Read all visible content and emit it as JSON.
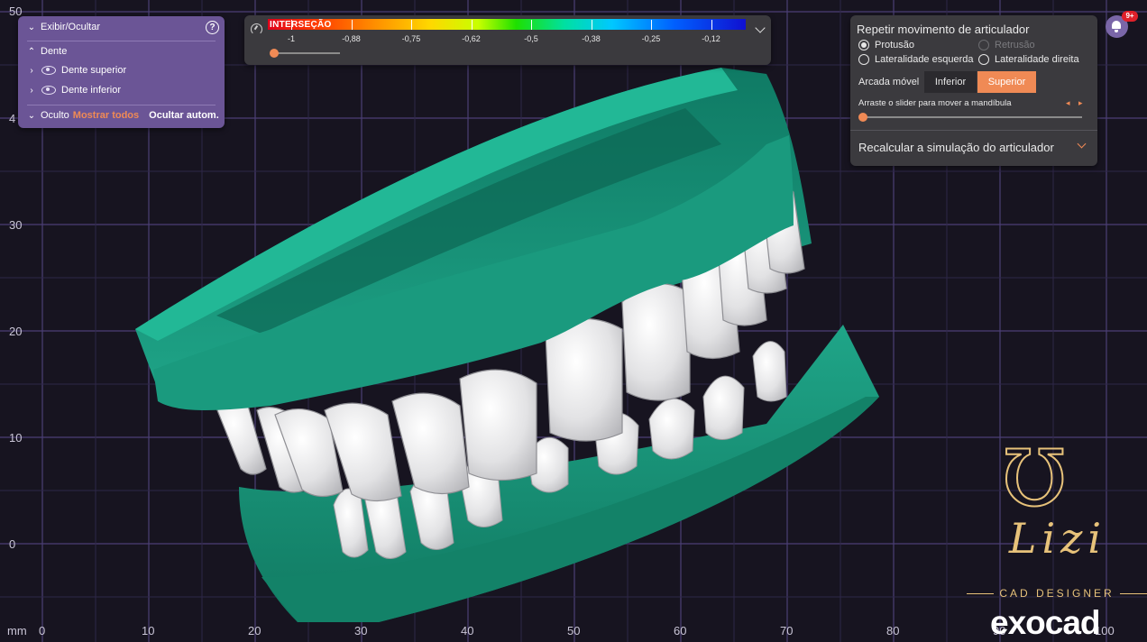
{
  "visibility_panel": {
    "title": "Exibir/Ocultar",
    "help_icon": "question-circle-icon",
    "group_label": "Dente",
    "items": [
      {
        "label": "Dente superior",
        "icon": "eye-icon"
      },
      {
        "label": "Dente inferior",
        "icon": "eye-icon"
      }
    ],
    "hidden_label": "Oculto",
    "show_all_label": "Mostrar todos",
    "auto_hide_label": "Ocultar autom."
  },
  "color_scale": {
    "title": "INTERSEÇÃO",
    "ticks": [
      "-1",
      "-0,88",
      "-0,75",
      "-0,62",
      "-0,5",
      "-0,38",
      "-0,25",
      "-0,12"
    ],
    "slider_value": 0.0
  },
  "articulator": {
    "title": "Repetir movimento de articulador",
    "options": [
      {
        "label": "Protusão",
        "selected": true,
        "disabled": false
      },
      {
        "label": "Retrusão",
        "selected": false,
        "disabled": true
      },
      {
        "label": "Lateralidade esquerda",
        "selected": false,
        "disabled": false
      },
      {
        "label": "Lateralidade direita",
        "selected": false,
        "disabled": false
      }
    ],
    "moving_arch_label": "Arcada móvel",
    "arch_buttons": [
      {
        "label": "Inferior",
        "active": false
      },
      {
        "label": "Superior",
        "active": true
      }
    ],
    "slider_hint": "Arraste o slider para mover a mandíbula",
    "slider_value": 0.0,
    "recalc_label": "Recalcular a simulação do articulador",
    "accent_color": "#f08a55"
  },
  "notifications": {
    "badge": "9+",
    "icon": "bell-icon"
  },
  "axis": {
    "unit": "mm",
    "y_ticks": [
      "50",
      "4",
      "30",
      "20",
      "10",
      "0"
    ],
    "x_ticks": [
      "0",
      "10",
      "20",
      "30",
      "40",
      "50",
      "60",
      "70",
      "80",
      "90",
      "100"
    ]
  },
  "branding": {
    "designer_name": "Lizi",
    "designer_sub": "CAD DESIGNER",
    "product": "exocad"
  },
  "colors": {
    "background": "#171420",
    "grid": "#4b3f75",
    "model_green": "#1fa588",
    "teeth": "#e9e9ea",
    "panel_purple": "#6b5596",
    "panel_dark": "#3b3a3e"
  }
}
